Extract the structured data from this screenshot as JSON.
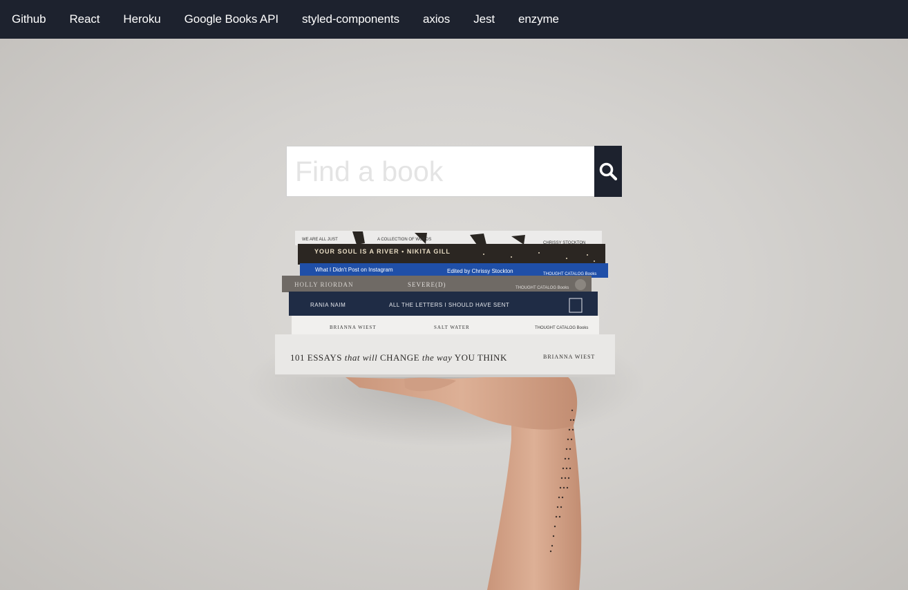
{
  "nav": {
    "links": [
      {
        "label": "Github"
      },
      {
        "label": "React"
      },
      {
        "label": "Heroku"
      },
      {
        "label": "Google Books API"
      },
      {
        "label": "styled-components"
      },
      {
        "label": "axios"
      },
      {
        "label": "Jest"
      },
      {
        "label": "enzyme"
      }
    ]
  },
  "search": {
    "placeholder": "Find a book",
    "value": "",
    "button_icon": "search-icon"
  },
  "hero": {
    "image": "hand-holding-stack-of-books-photo",
    "books": [
      {
        "spine": [
          "WE ARE ALL JUST",
          "A COLLECTION OF WORDS",
          "CHRISSY STOCKTON"
        ],
        "color": "#ecebea"
      },
      {
        "spine": [
          "YOUR SOUL IS A RIVER • NIKITA GILL"
        ],
        "color": "#2b2622"
      },
      {
        "spine": [
          "What I Didn't Post on Instagram",
          "Edited by Chrissy Stockton",
          "THOUGHT CATALOG Books"
        ],
        "color": "#1f4fa8"
      },
      {
        "spine": [
          "HOLLY RIORDAN",
          "SEVERE(D)",
          "THOUGHT CATALOG Books"
        ],
        "color": "#6f6a65"
      },
      {
        "spine": [
          "RANIA NAIM",
          "ALL THE LETTERS I SHOULD HAVE SENT"
        ],
        "color": "#1f2c45"
      },
      {
        "spine": [
          "BRIANNA WIEST",
          "SALT WATER",
          "THOUGHT CATALOG Books"
        ],
        "color": "#f1f0ee"
      },
      {
        "spine": [
          "101 ESSAYS that will CHANGE the way YOU THINK",
          "BRIANNA WIEST"
        ],
        "color": "#e9e8e6"
      }
    ]
  }
}
